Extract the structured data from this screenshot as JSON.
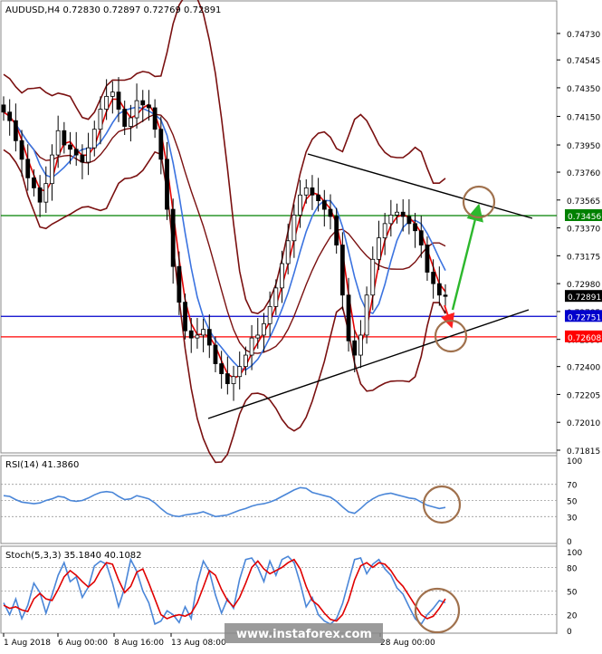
{
  "chart_data": [
    {
      "type": "candlestick",
      "title": "AUDUSD,H4  0.72830 0.72897 0.72769 0.72891",
      "ylim": [
        0.71815,
        0.7485
      ],
      "price_ticks": [
        "0.74730",
        "0.74545",
        "0.74350",
        "0.74150",
        "0.73950",
        "0.73760",
        "0.73565",
        "0.73370",
        "0.73175",
        "0.72980",
        "0.72785",
        "0.72590",
        "0.72400",
        "0.72205",
        "0.72010",
        "0.71815"
      ],
      "series": [
        {
          "name": "close",
          "values": [
            0.7418,
            0.7412,
            0.7398,
            0.7385,
            0.7372,
            0.7365,
            0.7355,
            0.7368,
            0.7388,
            0.7405,
            0.7395,
            0.7392,
            0.7388,
            0.7383,
            0.7393,
            0.7406,
            0.742,
            0.7429,
            0.7432,
            0.742,
            0.7408,
            0.7414,
            0.7426,
            0.7423,
            0.7421,
            0.7406,
            0.7385,
            0.735,
            0.731,
            0.7285,
            0.7265,
            0.726,
            0.7262,
            0.7266,
            0.7255,
            0.7242,
            0.7235,
            0.7228,
            0.7233,
            0.724,
            0.7248,
            0.726,
            0.7262,
            0.727,
            0.7282,
            0.7295,
            0.7312,
            0.7328,
            0.7346,
            0.736,
            0.7365,
            0.736,
            0.7356,
            0.735,
            0.7345,
            0.7325,
            0.729,
            0.7258,
            0.7248,
            0.7262,
            0.729,
            0.7315,
            0.733,
            0.734,
            0.7346,
            0.7348,
            0.7345,
            0.734,
            0.7335,
            0.7325,
            0.7306,
            0.7298,
            0.729,
            0.72891
          ]
        }
      ],
      "labels": [
        {
          "text": "0.73456",
          "value": 0.73456,
          "color": "#008000"
        },
        {
          "text": "0.72891",
          "value": 0.72891,
          "color": "#000000"
        },
        {
          "text": "0.72751",
          "value": 0.72751,
          "color": "#0000cc"
        },
        {
          "text": "0.72608",
          "value": 0.72608,
          "color": "#ff0000"
        }
      ],
      "x_ticks": [
        "1 Aug 2018",
        "6 Aug 00:00",
        "8 Aug 16:00",
        "13 Aug 08:00",
        "28 Aug 00:00"
      ],
      "grid": false
    },
    {
      "type": "line",
      "title": "RSI(14) 41.3860",
      "ylim": [
        0,
        100
      ],
      "tick_labels": [
        "100",
        "70",
        "50",
        "30",
        "0"
      ],
      "levels": [
        70,
        50,
        30
      ],
      "series": [
        {
          "name": "",
          "color": "#4a86d8",
          "values": [
            56,
            55,
            51,
            48,
            47,
            46,
            47,
            50,
            52,
            55,
            54,
            50,
            49,
            50,
            53,
            57,
            60,
            61,
            60,
            55,
            51,
            52,
            56,
            54,
            52,
            47,
            40,
            34,
            31,
            30,
            32,
            33,
            34,
            36,
            33,
            30,
            31,
            32,
            35,
            38,
            40,
            43,
            45,
            46,
            48,
            51,
            55,
            59,
            63,
            66,
            65,
            60,
            58,
            56,
            54,
            49,
            42,
            36,
            34,
            40,
            47,
            52,
            56,
            58,
            59,
            57,
            55,
            53,
            52,
            48,
            44,
            42,
            40,
            41.4
          ]
        }
      ]
    },
    {
      "type": "line",
      "title": "Stoch(5,3,3) 35.1840 40.1082",
      "ylim": [
        0,
        100
      ],
      "tick_labels": [
        "100",
        "80",
        "50",
        "20",
        "0"
      ],
      "levels": [
        80,
        50,
        20
      ],
      "series": [
        {
          "name": "",
          "color": "#4a86d8",
          "values": [
            35,
            20,
            40,
            15,
            32,
            60,
            48,
            22,
            45,
            70,
            86,
            62,
            68,
            42,
            55,
            82,
            88,
            84,
            60,
            30,
            54,
            90,
            75,
            50,
            35,
            8,
            12,
            25,
            20,
            10,
            30,
            15,
            60,
            88,
            75,
            45,
            22,
            40,
            28,
            65,
            90,
            92,
            80,
            62,
            88,
            70,
            90,
            94,
            86,
            60,
            30,
            42,
            20,
            12,
            8,
            15,
            34,
            62,
            90,
            92,
            72,
            84,
            90,
            78,
            70,
            54,
            46,
            30,
            15,
            8,
            20,
            28,
            38,
            35.2
          ]
        },
        {
          "name": "",
          "color": "#e00000",
          "values": [
            32,
            28,
            30,
            26,
            24,
            40,
            47,
            40,
            38,
            52,
            68,
            76,
            70,
            62,
            55,
            62,
            76,
            86,
            84,
            64,
            48,
            56,
            74,
            78,
            60,
            40,
            20,
            15,
            18,
            20,
            18,
            22,
            35,
            55,
            76,
            70,
            52,
            38,
            30,
            42,
            60,
            80,
            88,
            78,
            72,
            76,
            80,
            86,
            90,
            78,
            56,
            38,
            32,
            22,
            14,
            12,
            20,
            38,
            64,
            82,
            86,
            80,
            86,
            84,
            76,
            64,
            56,
            44,
            32,
            20,
            15,
            18,
            28,
            40.1
          ]
        }
      ]
    }
  ],
  "footer": {
    "watermark": "www.instaforex.com"
  },
  "colors": {
    "bollinger": "#7a1010",
    "fast_ma": "#e00000",
    "slow_ma": "#3b73e0",
    "resistance": "#008000",
    "support_blue": "#0000cc",
    "support_red": "#ff0000",
    "target_arrow": "#2db82d",
    "down_arrow": "#ff2020",
    "circle": "#a0714d"
  }
}
